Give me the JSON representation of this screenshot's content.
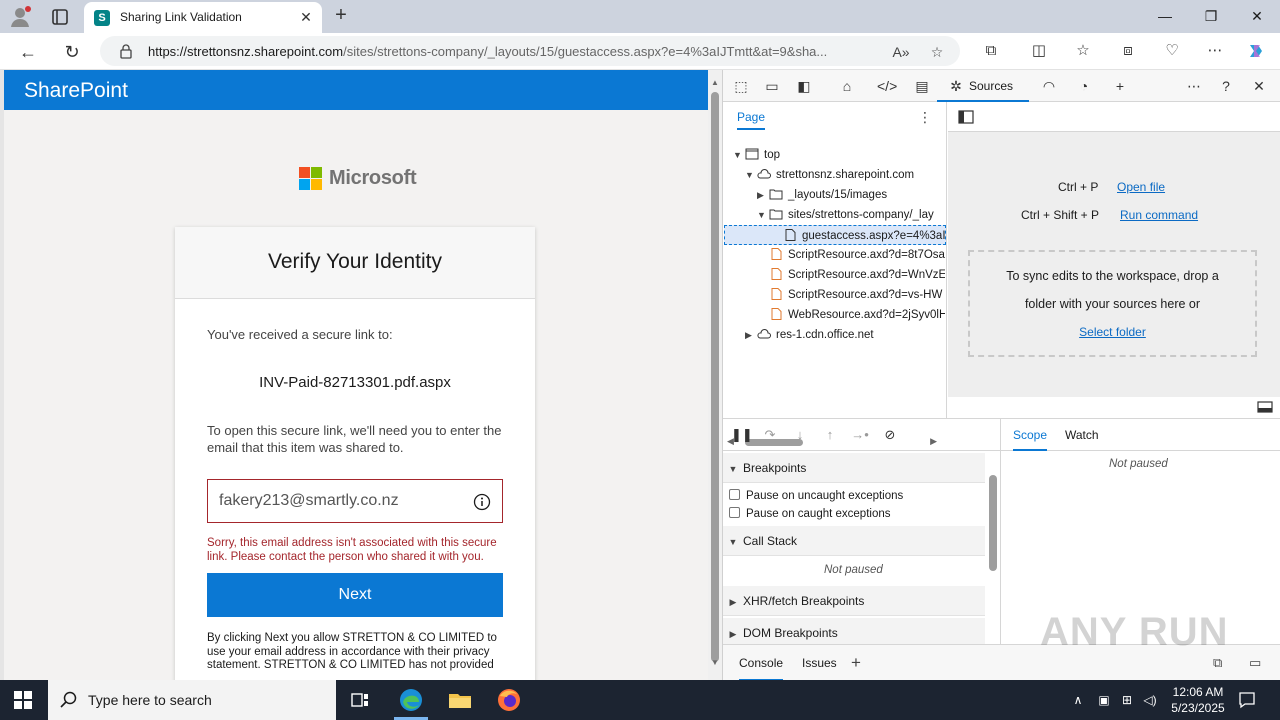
{
  "browser": {
    "tab_title": "Sharing Link Validation",
    "url_host": "https://strettonsnz.sharepoint.com",
    "url_path": "/sites/strettons-company/_layouts/15/guestaccess.aspx?e=4%3aIJTmtt&at=9&sha..."
  },
  "sharepoint": {
    "brand": "SharePoint",
    "ms_logo_text": "Microsoft",
    "card_title": "Verify Your Identity",
    "received_label": "You've received a secure link to:",
    "file_name": "INV-Paid-82713301.pdf.aspx",
    "instructions": "To open this secure link, we'll need you to enter the email that this item was shared to.",
    "email_value": "fakery213@smartly.co.nz",
    "error_text": "Sorry, this email address isn't associated with this secure link. Please contact the person who shared it with you.",
    "next_label": "Next",
    "legal_text": "By clicking Next you allow STRETTON & CO LIMITED to use your email address in accordance with their privacy statement. STRETTON & CO LIMITED has not provided"
  },
  "devtools": {
    "active_tab": "Sources",
    "nav_tab": "Page",
    "tree": [
      {
        "label": "top",
        "arrow": "▼",
        "icon": "frame"
      },
      {
        "label": "strettonsnz.sharepoint.com",
        "arrow": "▼",
        "icon": "cloud"
      },
      {
        "label": "_layouts/15/images",
        "arrow": "▶",
        "icon": "folder"
      },
      {
        "label": "sites/strettons-company/_lay",
        "arrow": "▼",
        "icon": "folder"
      },
      {
        "label": "guestaccess.aspx?e=4%3aI...",
        "arrow": "",
        "icon": "file"
      },
      {
        "label": "ScriptResource.axd?d=8t7Osa",
        "arrow": "",
        "icon": "file"
      },
      {
        "label": "ScriptResource.axd?d=WnVzE",
        "arrow": "",
        "icon": "file"
      },
      {
        "label": "ScriptResource.axd?d=vs-HW",
        "arrow": "",
        "icon": "file"
      },
      {
        "label": "WebResource.axd?d=2jSyv0lH",
        "arrow": "",
        "icon": "file"
      },
      {
        "label": "res-1.cdn.office.net",
        "arrow": "▶",
        "icon": "cloud"
      }
    ],
    "shortcut1_keys": "Ctrl + P",
    "shortcut1_link": "Open file",
    "shortcut2_keys": "Ctrl + Shift + P",
    "shortcut2_link": "Run command",
    "drop_line1": "To sync edits to the workspace, drop a",
    "drop_line2": "folder with your sources here or",
    "drop_link": "Select folder",
    "breakpoints_label": "Breakpoints",
    "pause_uncaught": "Pause on uncaught exceptions",
    "pause_caught": "Pause on caught exceptions",
    "callstack_label": "Call Stack",
    "not_paused": "Not paused",
    "xhr_label": "XHR/fetch Breakpoints",
    "dom_label": "DOM Breakpoints",
    "scope_tab": "Scope",
    "watch_tab": "Watch",
    "drawer_console": "Console",
    "drawer_issues": "Issues"
  },
  "watermark": "ANY RUN",
  "taskbar": {
    "search_placeholder": "Type here to search",
    "time": "12:06 AM",
    "date": "5/23/2025"
  }
}
